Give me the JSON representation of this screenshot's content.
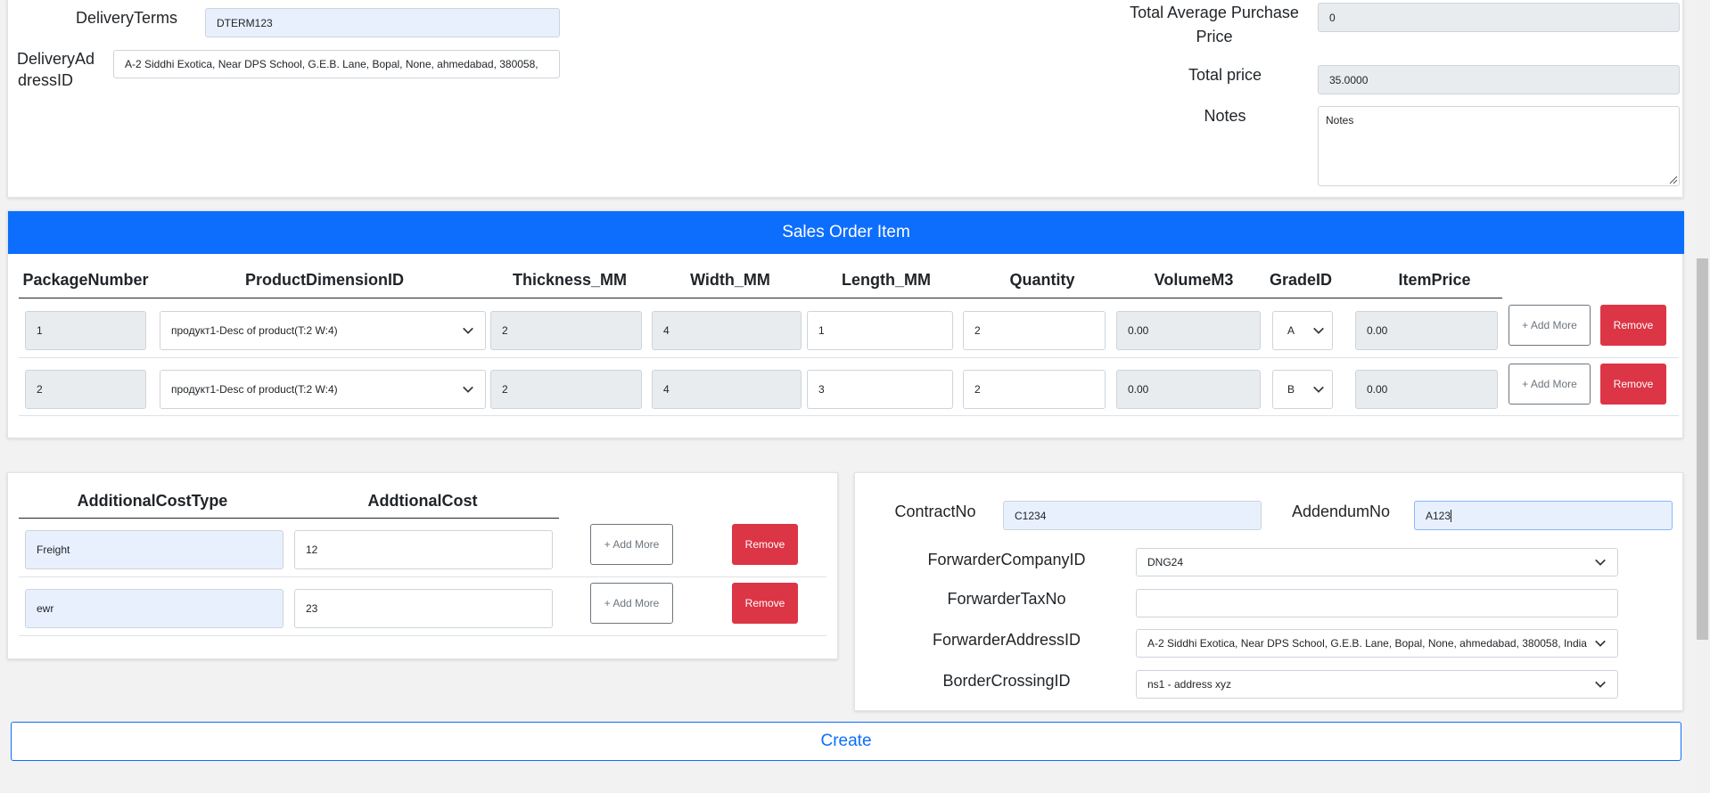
{
  "top_card": {
    "delivery_terms": {
      "label": "DeliveryTerms",
      "value": "DTERM123"
    },
    "delivery_address": {
      "label_line1": "DeliveryAd",
      "label_line2": "dressID",
      "value": "A-2 Siddhi Exotica, Near DPS School, G.E.B. Lane, Bopal, None, ahmedabad, 380058,"
    },
    "total_avg_purchase_price": {
      "label_line1": "Total Average Purchase",
      "label_line2": "Price",
      "value": "0"
    },
    "total_price": {
      "label": "Total price",
      "value": "35.0000"
    },
    "notes": {
      "label": "Notes",
      "value": "Notes"
    }
  },
  "sales_order_item": {
    "title": "Sales Order Item",
    "columns": [
      "PackageNumber",
      "ProductDimensionID",
      "Thickness_MM",
      "Width_MM",
      "Length_MM",
      "Quantity",
      "VolumeM3",
      "GradeID",
      "ItemPrice"
    ],
    "rows": [
      {
        "package": "1",
        "product": "продукт1-Desc of product(T:2 W:4)",
        "thickness": "2",
        "width": "4",
        "length": "1",
        "quantity": "2",
        "volume": "0.00",
        "grade": "A",
        "price": "0.00"
      },
      {
        "package": "2",
        "product": "продукт1-Desc of product(T:2 W:4)",
        "thickness": "2",
        "width": "4",
        "length": "3",
        "quantity": "2",
        "volume": "0.00",
        "grade": "B",
        "price": "0.00"
      }
    ],
    "add_label": "+ Add More",
    "remove_label": "Remove"
  },
  "additional_cost": {
    "columns": [
      "AdditionalCostType",
      "AddtionalCost"
    ],
    "rows": [
      {
        "type": "Freight",
        "cost": "12"
      },
      {
        "type": "ewr",
        "cost": "23"
      }
    ],
    "add_label": "+ Add More",
    "remove_label": "Remove"
  },
  "contract": {
    "contract_no": {
      "label": "ContractNo",
      "value": "C1234"
    },
    "addendum_no": {
      "label": "AddendumNo",
      "value": "A123"
    },
    "forwarder_company": {
      "label": "ForwarderCompanyID",
      "value": "DNG24"
    },
    "forwarder_tax": {
      "label": "ForwarderTaxNo",
      "value": ""
    },
    "forwarder_address": {
      "label": "ForwarderAddressID",
      "value": "A-2 Siddhi Exotica, Near DPS School, G.E.B. Lane, Bopal, None, ahmedabad, 380058, India"
    },
    "border_crossing": {
      "label": "BorderCrossingID",
      "value": "ns1 - address xyz"
    }
  },
  "create_label": "Create",
  "colors": {
    "primary": "#0d6efd",
    "danger": "#dc3545",
    "input_blue": "#e8f0fe",
    "input_gray": "#e9ecef"
  }
}
